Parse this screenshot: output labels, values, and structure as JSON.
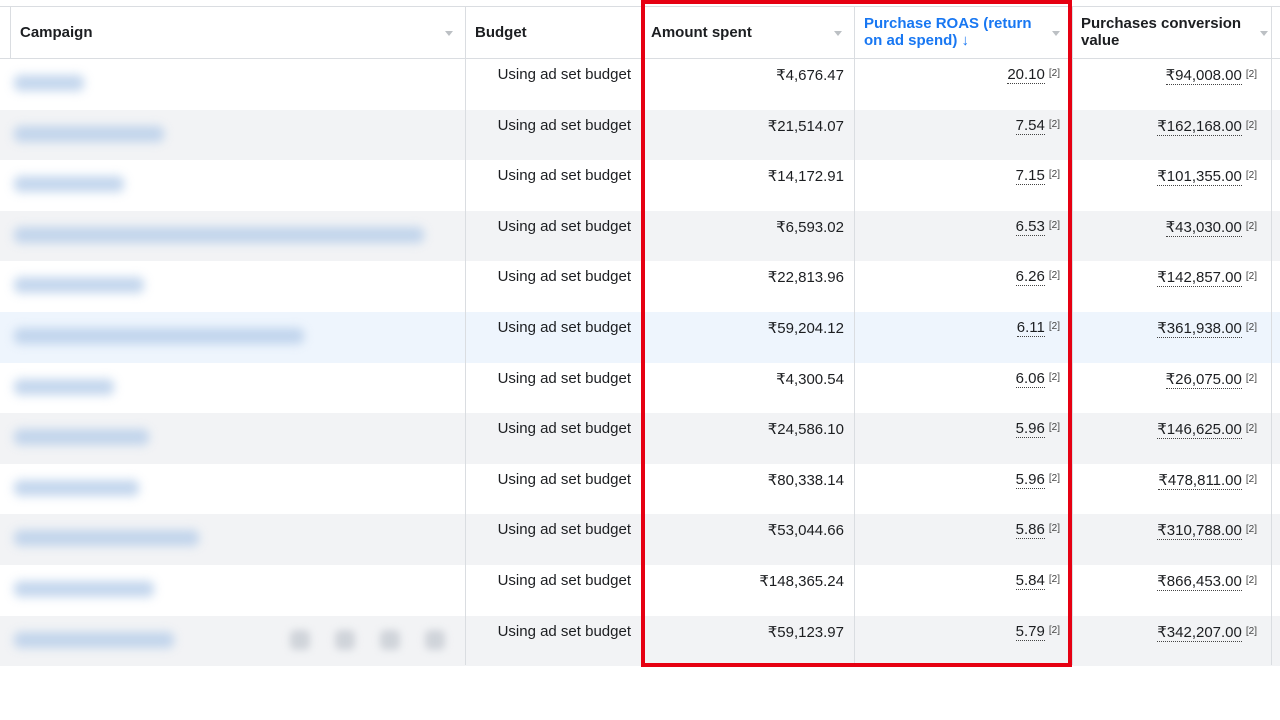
{
  "columns": {
    "campaign": "Campaign",
    "budget": "Budget",
    "amount_spent": "Amount spent",
    "roas_line1": "Purchase ROAS (return",
    "roas_line2": "on ad spend) ↓",
    "value_line1": "Purchases conversion",
    "value_line2": "value"
  },
  "colors": {
    "sorted_header": "#1877f2",
    "highlight_box": "#e60012",
    "row_alt": "#f2f3f5",
    "row_highlight": "#eef5fd"
  },
  "rows": [
    {
      "budget": "Using ad set budget",
      "spent": "₹4,676.47",
      "roas": "20.10",
      "roas_note": "[2]",
      "value": "₹94,008.00",
      "value_note": "[2]"
    },
    {
      "budget": "Using ad set budget",
      "spent": "₹21,514.07",
      "roas": "7.54",
      "roas_note": "[2]",
      "value": "₹162,168.00",
      "value_note": "[2]"
    },
    {
      "budget": "Using ad set budget",
      "spent": "₹14,172.91",
      "roas": "7.15",
      "roas_note": "[2]",
      "value": "₹101,355.00",
      "value_note": "[2]"
    },
    {
      "budget": "Using ad set budget",
      "spent": "₹6,593.02",
      "roas": "6.53",
      "roas_note": "[2]",
      "value": "₹43,030.00",
      "value_note": "[2]"
    },
    {
      "budget": "Using ad set budget",
      "spent": "₹22,813.96",
      "roas": "6.26",
      "roas_note": "[2]",
      "value": "₹142,857.00",
      "value_note": "[2]"
    },
    {
      "budget": "Using ad set budget",
      "spent": "₹59,204.12",
      "roas": "6.11",
      "roas_note": "[2]",
      "value": "₹361,938.00",
      "value_note": "[2]"
    },
    {
      "budget": "Using ad set budget",
      "spent": "₹4,300.54",
      "roas": "6.06",
      "roas_note": "[2]",
      "value": "₹26,075.00",
      "value_note": "[2]"
    },
    {
      "budget": "Using ad set budget",
      "spent": "₹24,586.10",
      "roas": "5.96",
      "roas_note": "[2]",
      "value": "₹146,625.00",
      "value_note": "[2]"
    },
    {
      "budget": "Using ad set budget",
      "spent": "₹80,338.14",
      "roas": "5.96",
      "roas_note": "[2]",
      "value": "₹478,811.00",
      "value_note": "[2]"
    },
    {
      "budget": "Using ad set budget",
      "spent": "₹53,044.66",
      "roas": "5.86",
      "roas_note": "[2]",
      "value": "₹310,788.00",
      "value_note": "[2]"
    },
    {
      "budget": "Using ad set budget",
      "spent": "₹148,365.24",
      "roas": "5.84",
      "roas_note": "[2]",
      "value": "₹866,453.00",
      "value_note": "[2]"
    },
    {
      "budget": "Using ad set budget",
      "spent": "₹59,123.97",
      "roas": "5.79",
      "roas_note": "[2]",
      "value": "₹342,207.00",
      "value_note": "[2]"
    }
  ]
}
